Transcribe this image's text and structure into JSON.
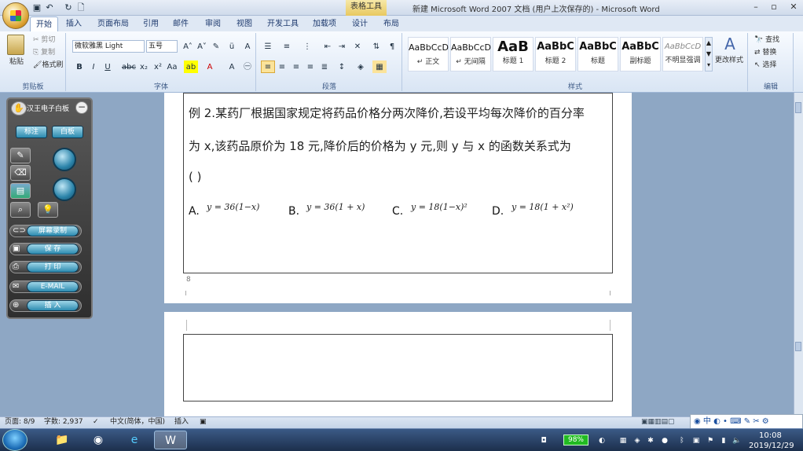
{
  "window": {
    "title": "新建 Microsoft Word 2007 文档 (用户上次保存的) - Microsoft Word",
    "context_tab": "表格工具"
  },
  "tabs": [
    "开始",
    "插入",
    "页面布局",
    "引用",
    "邮件",
    "审阅",
    "视图",
    "开发工具",
    "加载项",
    "设计",
    "布局"
  ],
  "ribbon": {
    "clipboard": {
      "label": "剪贴板",
      "paste": "粘贴",
      "cut": "剪切",
      "copy": "复制",
      "format_painter": "格式刷"
    },
    "font": {
      "label": "字体",
      "font_name": "微软雅黑 Light",
      "font_size": "五号"
    },
    "paragraph": {
      "label": "段落"
    },
    "styles": {
      "label": "样式",
      "items": [
        {
          "sample": "AaBbCcD",
          "name": "↵ 正文"
        },
        {
          "sample": "AaBbCcD",
          "name": "↵ 无间隔"
        },
        {
          "sample": "AaB",
          "name": "标题 1"
        },
        {
          "sample": "AaBbC",
          "name": "标题 2"
        },
        {
          "sample": "AaBbC",
          "name": "标题"
        },
        {
          "sample": "AaBbC",
          "name": "副标题"
        },
        {
          "sample": "AaBbCcD",
          "name": "不明显强调"
        }
      ],
      "change_styles": "更改样式"
    },
    "editing": {
      "label": "编辑",
      "find": "查找",
      "replace": "替换",
      "select": "选择"
    }
  },
  "document": {
    "question_line1": "例 2.某药厂根据国家规定将药品价格分两次降价,若设平均每次降价的百分率",
    "question_line2": "为 x,该药品原价为 18 元,降价后的价格为 y 元,则 y 与 x 的函数关系式为",
    "blank": "(        )",
    "options": [
      {
        "label": "A.",
        "formula": "y = 36(1−x)"
      },
      {
        "label": "B.",
        "formula": "y = 36(1 + x)"
      },
      {
        "label": "C.",
        "formula": "y = 18(1−x)²"
      },
      {
        "label": "D.",
        "formula": "y = 18(1 + x²)"
      }
    ],
    "page_number": "8"
  },
  "side_panel": {
    "title": "汉王电子白板",
    "btn_annotate": "标注",
    "btn_whiteboard": "白板",
    "btn_record": "屏幕录制",
    "btn_save": "保 存",
    "btn_print": "打 印",
    "btn_email": "E-MAIL",
    "btn_insert": "插 入"
  },
  "status": {
    "page": "页面: 8/9",
    "words": "字数: 2,937",
    "language": "中文(简体，中国)",
    "mode": "插入"
  },
  "ime": "中",
  "taskbar": {
    "battery": "98%",
    "time": "10:08",
    "date": "2019/12/29"
  }
}
